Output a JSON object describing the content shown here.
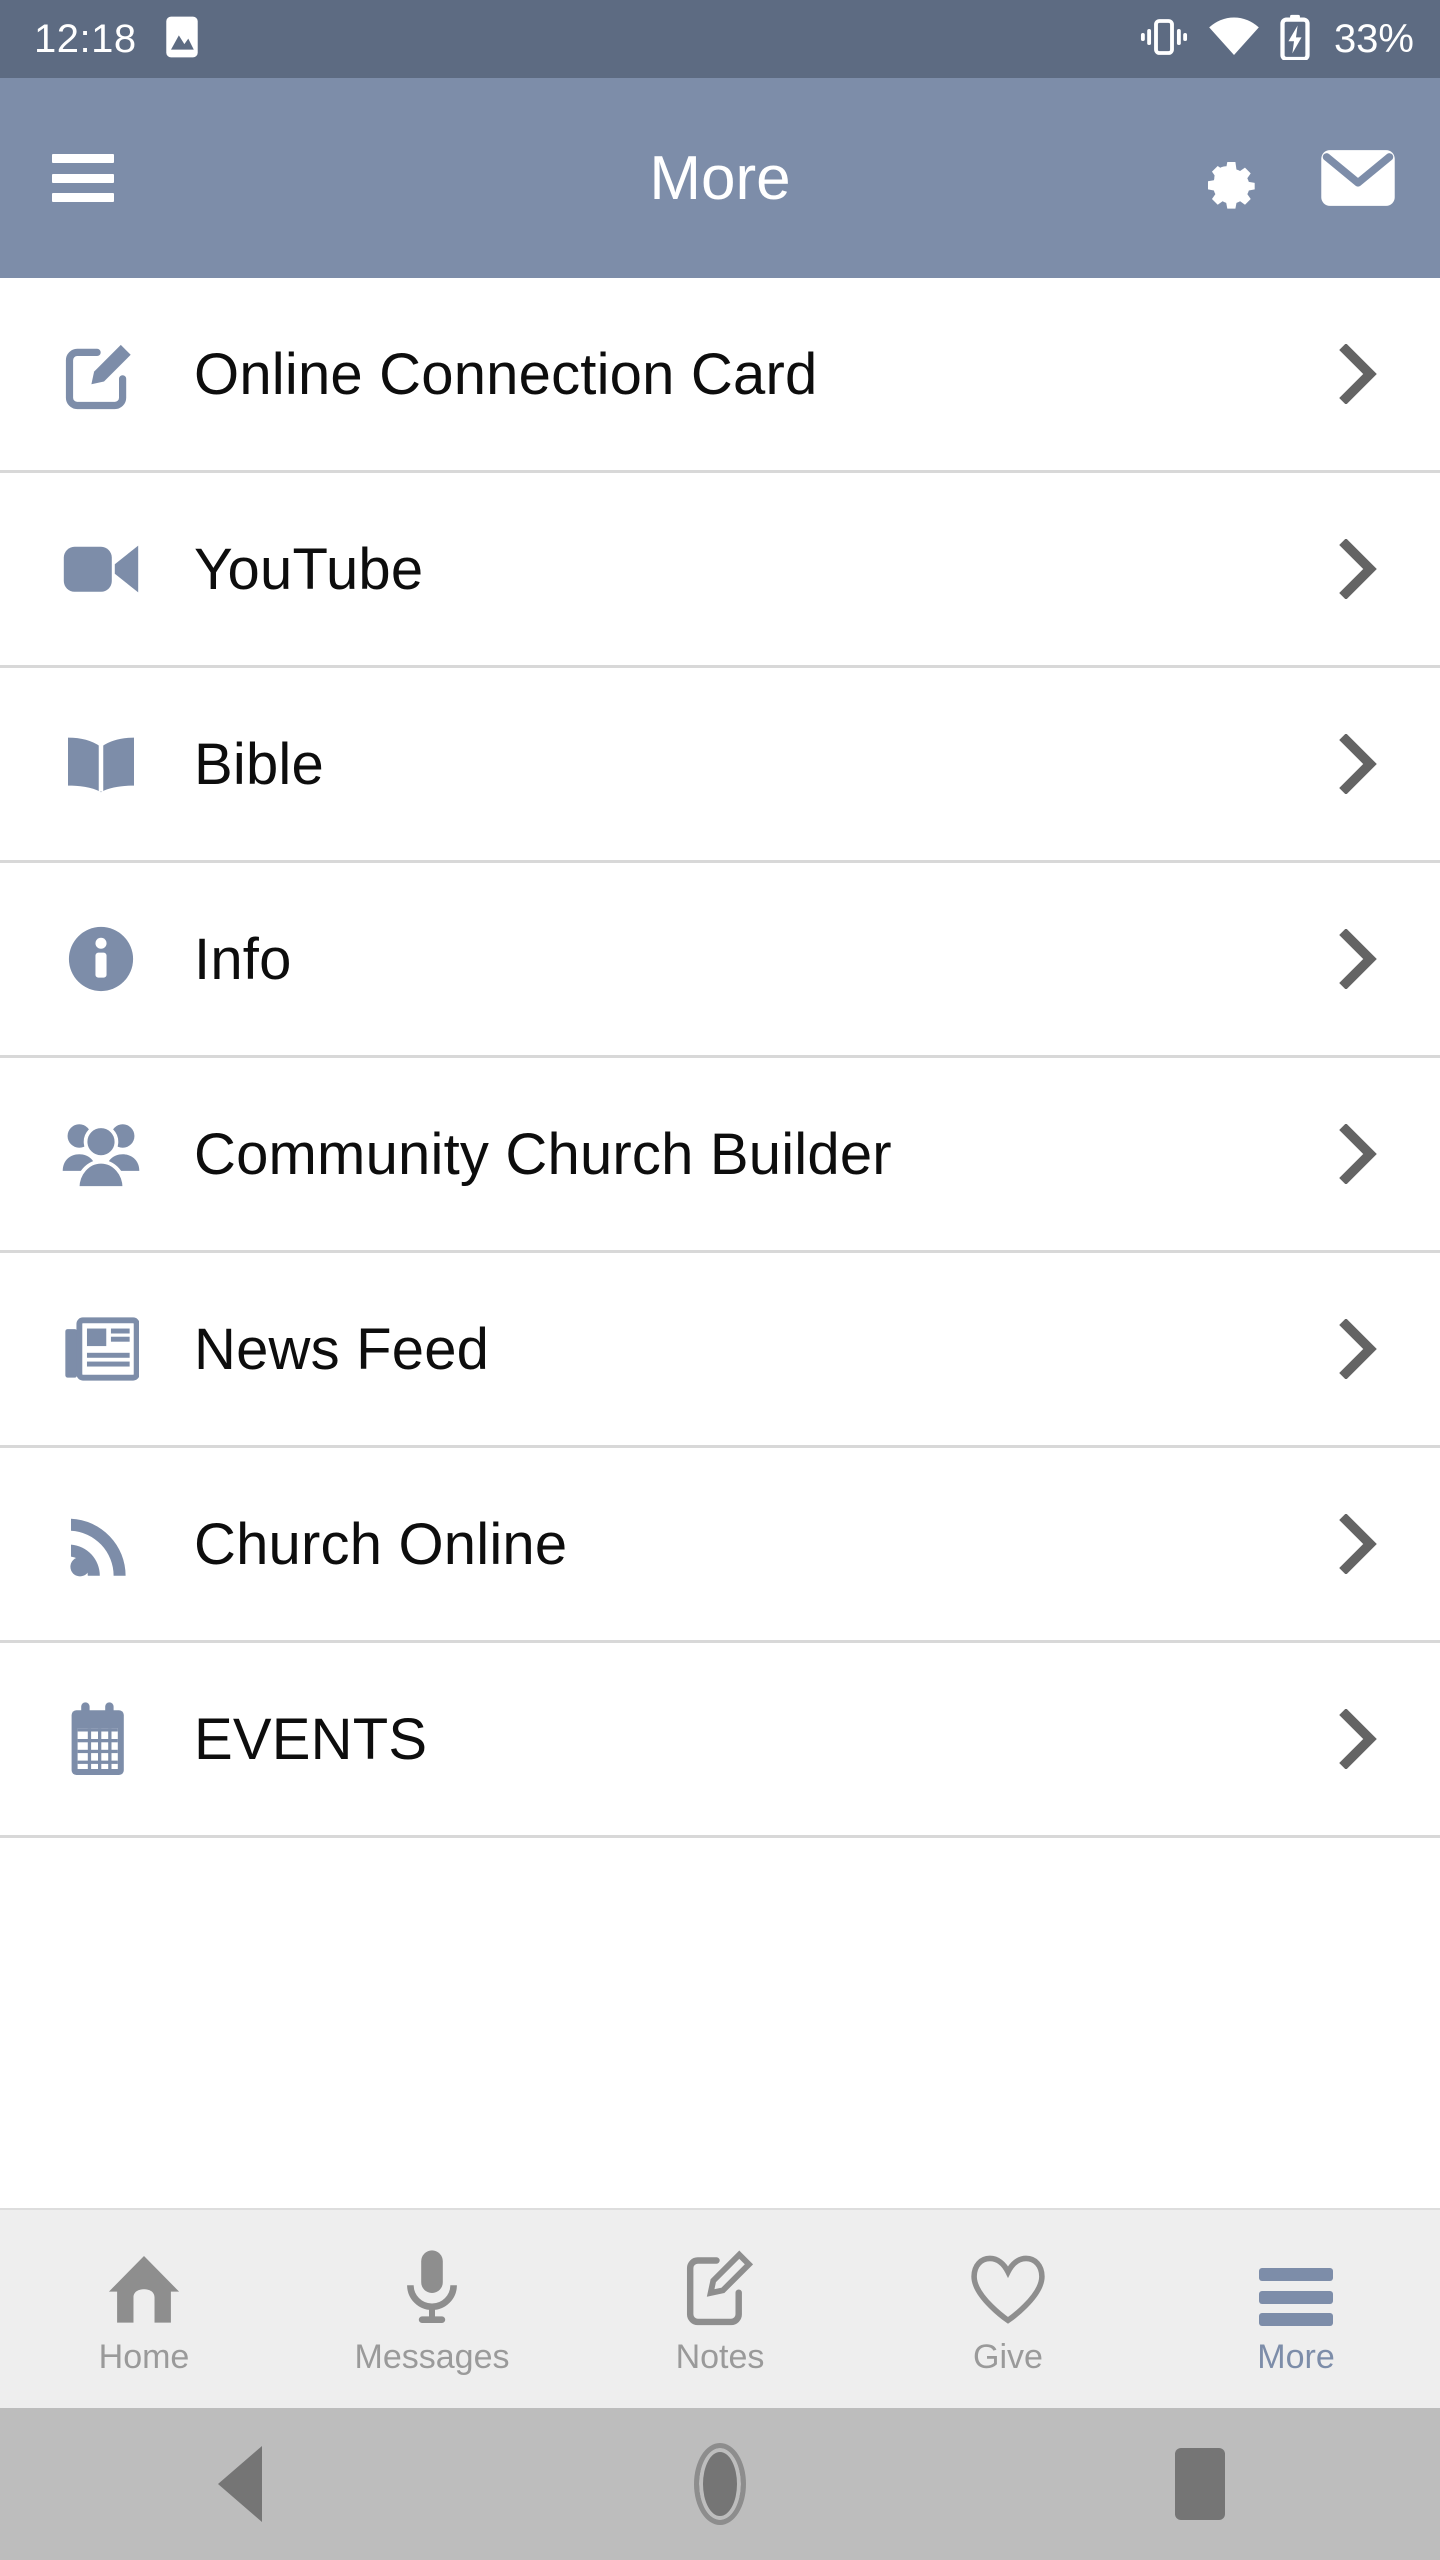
{
  "statusbar": {
    "time": "12:18",
    "left_icons": [
      "image-icon"
    ],
    "right_icons": [
      "vibrate-icon",
      "wifi-icon",
      "battery-charging-icon"
    ],
    "battery_percent": "33%"
  },
  "appbar": {
    "menu_icon": "hamburger-icon",
    "title": "More",
    "actions": [
      {
        "name": "settings-gear-icon",
        "label": "Settings"
      },
      {
        "name": "envelope-icon",
        "label": "Messages"
      }
    ],
    "background_color": "#7d8da9"
  },
  "list": {
    "items": [
      {
        "label": "Online Connection Card",
        "icon": "edit-card-icon",
        "chevron": "chevron-right-icon"
      },
      {
        "label": "YouTube",
        "icon": "video-camera-icon",
        "chevron": "chevron-right-icon"
      },
      {
        "label": "Bible",
        "icon": "open-book-icon",
        "chevron": "chevron-right-icon"
      },
      {
        "label": "Info",
        "icon": "info-circle-icon",
        "chevron": "chevron-right-icon"
      },
      {
        "label": "Community Church Builder",
        "icon": "people-group-icon",
        "chevron": "chevron-right-icon"
      },
      {
        "label": "News Feed",
        "icon": "newspaper-icon",
        "chevron": "chevron-right-icon"
      },
      {
        "label": "Church Online",
        "icon": "rss-signal-icon",
        "chevron": "chevron-right-icon"
      },
      {
        "label": "EVENTS",
        "icon": "calendar-icon",
        "chevron": "chevron-right-icon"
      }
    ],
    "icon_color": "#7d8da9",
    "divider_color": "#d8d8d8"
  },
  "tabbar": {
    "tabs": [
      {
        "label": "Home",
        "icon": "home-icon",
        "active": false
      },
      {
        "label": "Messages",
        "icon": "microphone-icon",
        "active": false
      },
      {
        "label": "Notes",
        "icon": "note-edit-icon",
        "active": false
      },
      {
        "label": "Give",
        "icon": "heart-icon",
        "active": false
      },
      {
        "label": "More",
        "icon": "hamburger-icon",
        "active": true
      }
    ],
    "active_color": "#7d8da9",
    "inactive_color": "#9a9a9a"
  },
  "navbar": {
    "buttons": [
      {
        "name": "android-back-button",
        "icon": "triangle-left-icon"
      },
      {
        "name": "android-home-button",
        "icon": "circle-icon"
      },
      {
        "name": "android-recents-button",
        "icon": "square-icon"
      }
    ]
  }
}
